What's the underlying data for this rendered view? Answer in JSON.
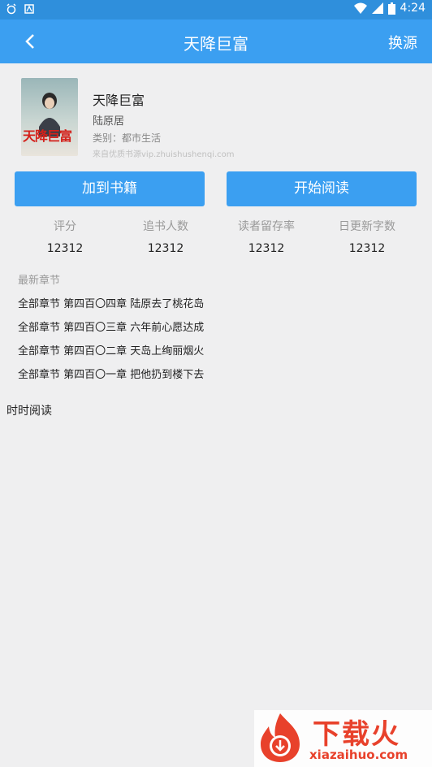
{
  "statusbar": {
    "time": "4:24",
    "left_icons": [
      "alarm-icon",
      "notification-icon"
    ],
    "right_icons": [
      "wifi-icon",
      "signal-icon",
      "battery-icon"
    ]
  },
  "appbar": {
    "title": "天降巨富",
    "switch_source": "换源",
    "back_icon": "chevron-left-icon"
  },
  "book": {
    "title": "天降巨富",
    "author": "陆原居",
    "category": "类别：都市生活",
    "source": "来自优质书源vip.zhuishushenqi.com",
    "cover_text": "天降巨富"
  },
  "actions": {
    "add_to_shelf": "加到书籍",
    "start_reading": "开始阅读"
  },
  "stats": [
    {
      "label": "评分",
      "value": "12312"
    },
    {
      "label": "追书人数",
      "value": "12312"
    },
    {
      "label": "读者留存率",
      "value": "12312"
    },
    {
      "label": "日更新字数",
      "value": "12312"
    }
  ],
  "latest": {
    "heading": "最新章节",
    "chapters": [
      "全部章节 第四百〇四章 陆原去了桃花岛",
      "全部章节 第四百〇三章 六年前心愿达成",
      "全部章节 第四百〇二章 天岛上绚丽烟火",
      "全部章节 第四百〇一章 把他扔到楼下去"
    ]
  },
  "read_now": "时时阅读",
  "watermark": {
    "brand": "下载火",
    "url": "xiazaihuo.com"
  },
  "colors": {
    "primary": "#3b9ff1",
    "background": "#efeff0",
    "watermark": "#e8412b"
  }
}
